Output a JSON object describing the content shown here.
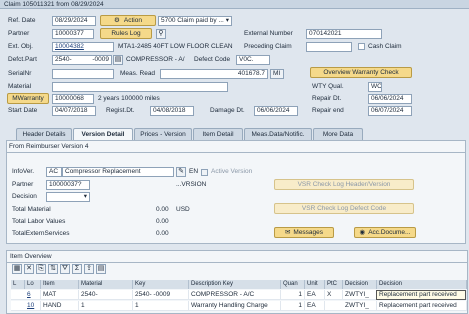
{
  "title": "Claim 105011321 from 08/29/2024",
  "header": {
    "ref_date_label": "Ref. Date",
    "ref_date": "08/29/2024",
    "action_label": "Action",
    "status_select": "5700 Claim paid by ...",
    "partner_label": "Partner",
    "partner": "10000377",
    "rules_log_label": "Rules Log",
    "external_number_label": "External Number",
    "external_number": "070142021",
    "ext_obj_label": "Ext. Obj.",
    "ext_obj": "10004382",
    "ext_obj_desc": "MTA1-2485 40FT LOW FLOOR CLEAN",
    "preceding_claim_label": "Preceding Claim",
    "cash_claim_label": "Cash Claim",
    "defct_part_label": "Defct.Part",
    "defct_part": "2540-",
    "defct_part_suffix": "-0009",
    "defct_part_desc": "COMPRESSOR - A/",
    "defect_code_label": "Defect Code",
    "defect_code": "V0C.",
    "serial_nr_label": "SerialNr",
    "meas_read_label": "Meas. Read",
    "meas_read_value": "401678.7",
    "meas_read_unit": "MI",
    "overview_warranty_check_label": "Overview Warranty Check",
    "material_label": "Material",
    "wty_qual_label": "WTY Qual.",
    "wty_qual": "WC",
    "mwarranty_label": "MWarranty",
    "mwarranty_value": "10000068",
    "mwarranty_desc": "2 years 100000 miles",
    "repair_dt_label": "Repair Dt.",
    "repair_dt": "06/06/2024",
    "start_date_label": "Start Date",
    "start_date": "04/07/2018",
    "regist_dt_label": "Regist.Dt.",
    "regist_dt": "04/08/2018",
    "damage_dt_label": "Damage Dt.",
    "damage_dt": "06/06/2024",
    "repair_end_label": "Repair end",
    "repair_end": "06/07/2024"
  },
  "tabs": [
    {
      "label": "Header Details"
    },
    {
      "label": "Version Detail"
    },
    {
      "label": "Prices - Version"
    },
    {
      "label": "Item Detail"
    },
    {
      "label": "Meas.Data/Notific."
    },
    {
      "label": "More Data"
    }
  ],
  "version": {
    "section_title": "From Reimburser Version 4",
    "infover_label": "InfoVer.",
    "infover_code": "AC",
    "infover_desc": "Compressor Replacement",
    "lang": "EN",
    "active_version_label": "Active Version",
    "partner_label": "Partner",
    "partner": "10000037?",
    "partner_desc": "...VRSION",
    "decision_label": "Decision",
    "vsr_header_label": "VSR Check Log Header/Version",
    "vsr_defect_label": "VSR Check Log Defect Code",
    "total_material_label": "Total Material",
    "total_material": "0.00",
    "currency": "USD",
    "total_labor_label": "Total Labor Values",
    "total_labor": "0.00",
    "total_extern_label": "TotalExternServices",
    "total_extern": "0.00",
    "messages_label": "Messages",
    "acc_docume_label": "Acc.Docume..."
  },
  "items": {
    "section_title": "Item Overview",
    "columns": [
      "L",
      "Lo",
      "Item",
      "Material",
      "Key",
      "Description Key",
      "Quan",
      "Unit",
      "PtC",
      "Decision",
      "Decision"
    ],
    "rows": [
      {
        "lo": "6",
        "item": "MAT",
        "material": "2540-",
        "material2": "-0009",
        "key": "2540-    -0009",
        "desc": "COMPRESSOR - A/C",
        "quan": "1",
        "unit": "EA",
        "ptc": "X",
        "decision": "ZWTYI_",
        "decision_text": "Replacement part received"
      },
      {
        "lo": "10",
        "item": "HAND",
        "material": "1",
        "material2": "",
        "key": "1",
        "desc": "Warranty Handling Charge",
        "quan": "1",
        "unit": "EA",
        "ptc": "",
        "decision": "ZWTYI_",
        "decision_text": "Replacement part received"
      }
    ]
  }
}
